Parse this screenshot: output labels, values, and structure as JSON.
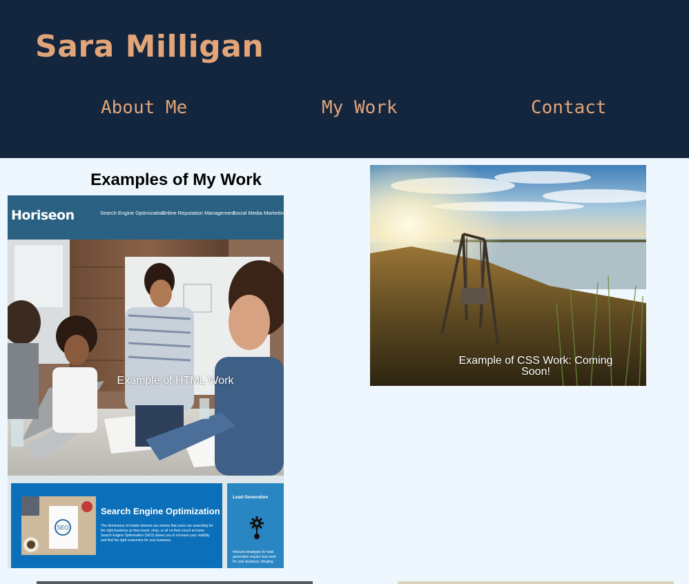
{
  "header": {
    "title": "Sara Milligan",
    "nav": [
      {
        "label": "About Me"
      },
      {
        "label": "My Work"
      },
      {
        "label": "Contact"
      }
    ]
  },
  "work": {
    "title": "Examples of My Work",
    "cards": [
      {
        "caption": "Example of HTML Work"
      },
      {
        "caption": "Example of CSS Work: Coming Soon!"
      }
    ]
  },
  "horiseon": {
    "logo": "Horiseon",
    "nav": [
      "Search Engine Optimization",
      "Online Reputation Management",
      "Social Media Marketing"
    ],
    "seo_title": "Search Engine Optimization",
    "seo_text": "The dominance of mobile internet use means that users are searching for the right business as they travel, shop, or sit on their couch at home. Search Engine Optimization (SEO) allows you to increase your visibility and find the right customers for your business.",
    "seo_badge": "SEO",
    "lead_title": "Lead Generation",
    "lead_text": "Inbound strategies for lead generation require less work for your business, bringing"
  },
  "colors": {
    "header_bg": "#13263d",
    "accent": "#e2a57a",
    "page_bg": "#eef7fd"
  }
}
